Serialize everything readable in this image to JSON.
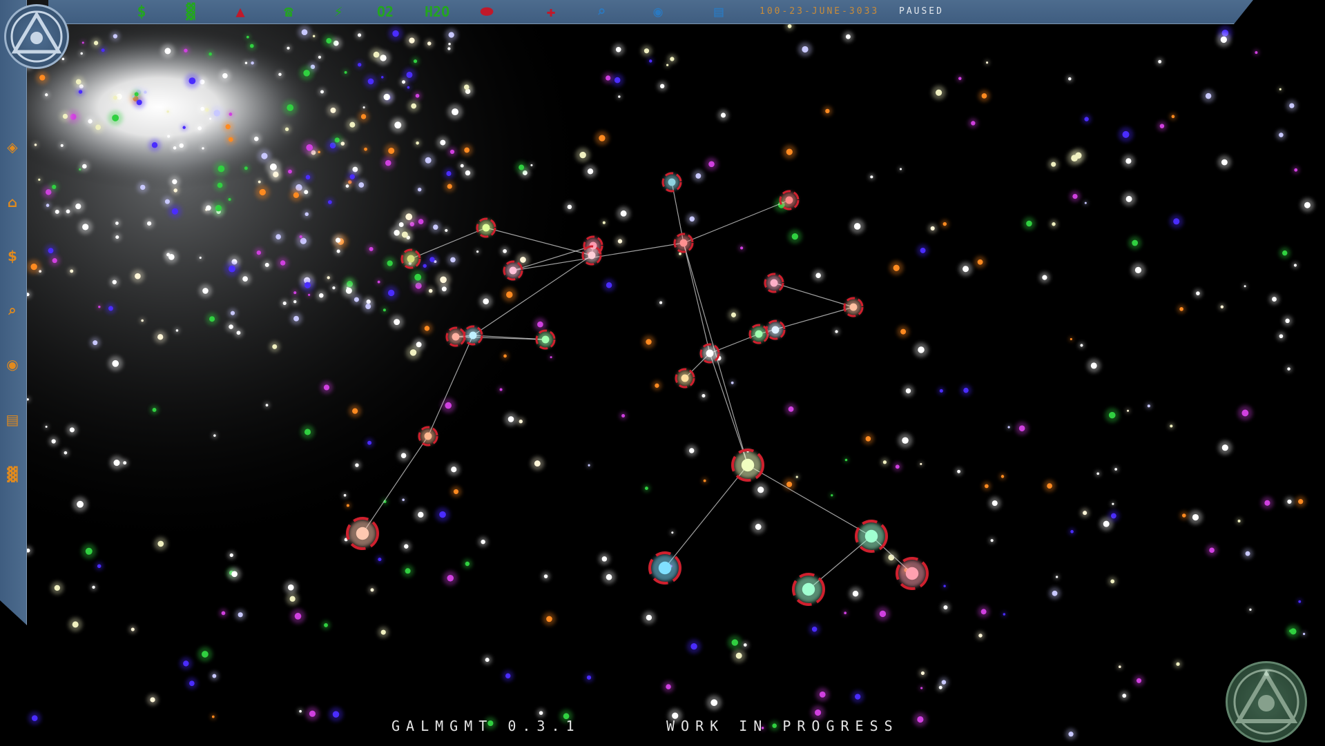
{
  "top_bar": {
    "icons": [
      {
        "name": "money-icon",
        "glyph": "$",
        "color": "#23a61f"
      },
      {
        "name": "population-icon",
        "glyph": "▓",
        "color": "#23a61f"
      },
      {
        "name": "threat-icon",
        "glyph": "▲",
        "color": "#c0192a"
      },
      {
        "name": "communications-icon",
        "glyph": "☎",
        "color": "#23a61f"
      },
      {
        "name": "energy-icon",
        "glyph": "⚡",
        "color": "#23a61f"
      },
      {
        "name": "oxygen-icon",
        "glyph": "O2",
        "color": "#23a61f"
      },
      {
        "name": "water-icon",
        "glyph": "H2O",
        "color": "#23a61f"
      },
      {
        "name": "medicine-pill-icon",
        "glyph": "⬬",
        "color": "#c0192a"
      },
      {
        "name": "medical-cross-icon",
        "glyph": "✚",
        "color": "#c0192a"
      },
      {
        "name": "search-icon",
        "glyph": "⌕",
        "color": "#2b79c0"
      },
      {
        "name": "surveillance-eye-icon",
        "glyph": "◉",
        "color": "#2b79c0"
      },
      {
        "name": "logbook-icon",
        "glyph": "▤",
        "color": "#2b79c0"
      }
    ],
    "datetime": "100-23-JUNE-3033",
    "status": "PAUSED"
  },
  "sidebar": {
    "icons": [
      {
        "name": "faction-emblem-icon",
        "glyph": "◈"
      },
      {
        "name": "factory-icon",
        "glyph": "⌂"
      },
      {
        "name": "money-icon",
        "glyph": "$"
      },
      {
        "name": "search-icon",
        "glyph": "⌕"
      },
      {
        "name": "surveillance-eye-icon",
        "glyph": "◉"
      },
      {
        "name": "logbook-icon",
        "glyph": "▤"
      },
      {
        "name": "population-icon",
        "glyph": "▓"
      }
    ]
  },
  "bottom": {
    "version": "GALMGMT 0.3.1",
    "notice": "WORK IN PROGRESS"
  },
  "colors": {
    "panel": "#4a688c",
    "panel_edge": "#8ea6c0",
    "accent_orange": "#e08a1e",
    "ok_green": "#23a61f",
    "alert_red": "#c0192a",
    "info_blue": "#2b79c0"
  },
  "systems": [
    {
      "id": "s1",
      "color": "#8fd3e0"
    },
    {
      "id": "s2",
      "color": "#ff8a8a"
    },
    {
      "id": "s3",
      "color": "#ff9ab0"
    },
    {
      "id": "s4",
      "color": "#ffc0d8"
    },
    {
      "id": "s5",
      "color": "#ff9090"
    },
    {
      "id": "s6",
      "color": "#e0ff9a"
    },
    {
      "id": "s7",
      "color": "#d8e080"
    },
    {
      "id": "s8",
      "color": "#ffd0d8"
    },
    {
      "id": "s9",
      "color": "#c0f0ff"
    },
    {
      "id": "s10",
      "color": "#ffb0a0"
    },
    {
      "id": "s11",
      "color": "#a0ffb0"
    },
    {
      "id": "s12",
      "color": "#ffb0c8"
    },
    {
      "id": "s13",
      "color": "#ffc0a0"
    },
    {
      "id": "s14",
      "color": "#ffffff"
    },
    {
      "id": "s15",
      "color": "#a0ffb0"
    },
    {
      "id": "s16",
      "color": "#ffe0a0"
    },
    {
      "id": "s17",
      "color": "#e0f0ff"
    },
    {
      "id": "s18",
      "color": "#ffc8b0"
    },
    {
      "id": "s19",
      "color": "#ffb890"
    },
    {
      "id": "s20",
      "color": "#f0ffc0"
    },
    {
      "id": "s21",
      "color": "#80e0ff"
    },
    {
      "id": "s22",
      "color": "#a0ffd0"
    },
    {
      "id": "s23",
      "color": "#a0ffd0"
    },
    {
      "id": "s24",
      "color": "#ffa0b0"
    }
  ],
  "lanes": [
    [
      "s1",
      "s5"
    ],
    [
      "s2",
      "s5"
    ],
    [
      "s5",
      "s4"
    ],
    [
      "s4",
      "s3"
    ],
    [
      "s3",
      "s8"
    ],
    [
      "s8",
      "s6"
    ],
    [
      "s6",
      "s7"
    ],
    [
      "s8",
      "s9"
    ],
    [
      "s9",
      "s10"
    ],
    [
      "s10",
      "s11"
    ],
    [
      "s9",
      "s19"
    ],
    [
      "s19",
      "s18"
    ],
    [
      "s5",
      "s14"
    ],
    [
      "s14",
      "s20"
    ],
    [
      "s12",
      "s13"
    ],
    [
      "s13",
      "s15"
    ],
    [
      "s15",
      "s14"
    ],
    [
      "s14",
      "s16"
    ],
    [
      "s11",
      "s9"
    ],
    [
      "s5",
      "s20"
    ],
    [
      "s20",
      "s21"
    ],
    [
      "s20",
      "s23"
    ],
    [
      "s23",
      "s22"
    ],
    [
      "s23",
      "s24"
    ]
  ]
}
